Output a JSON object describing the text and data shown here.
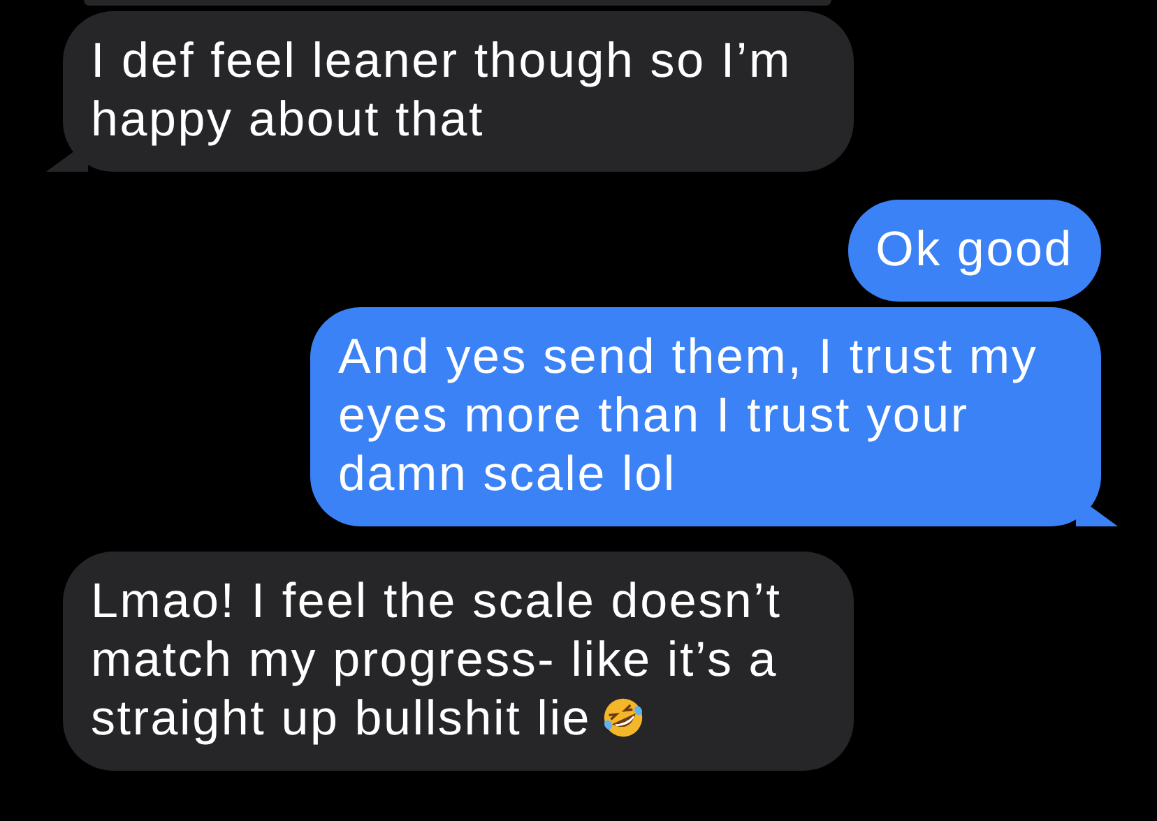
{
  "earlier_message_visible": true,
  "messages": [
    {
      "kind": "received",
      "text": "I def feel leaner though so I’m happy about that",
      "tail": true,
      "emoji": false
    },
    {
      "kind": "sent",
      "text": "Ok good",
      "tail": false,
      "emoji": false
    },
    {
      "kind": "sent",
      "text": "And yes send them, I trust my eyes more than I trust your damn scale lol",
      "tail": true,
      "emoji": false
    },
    {
      "kind": "received",
      "text": "Lmao! I feel the scale doesn’t match my progress- like it’s a straight up bullshit lie",
      "tail": false,
      "emoji": true
    }
  ]
}
